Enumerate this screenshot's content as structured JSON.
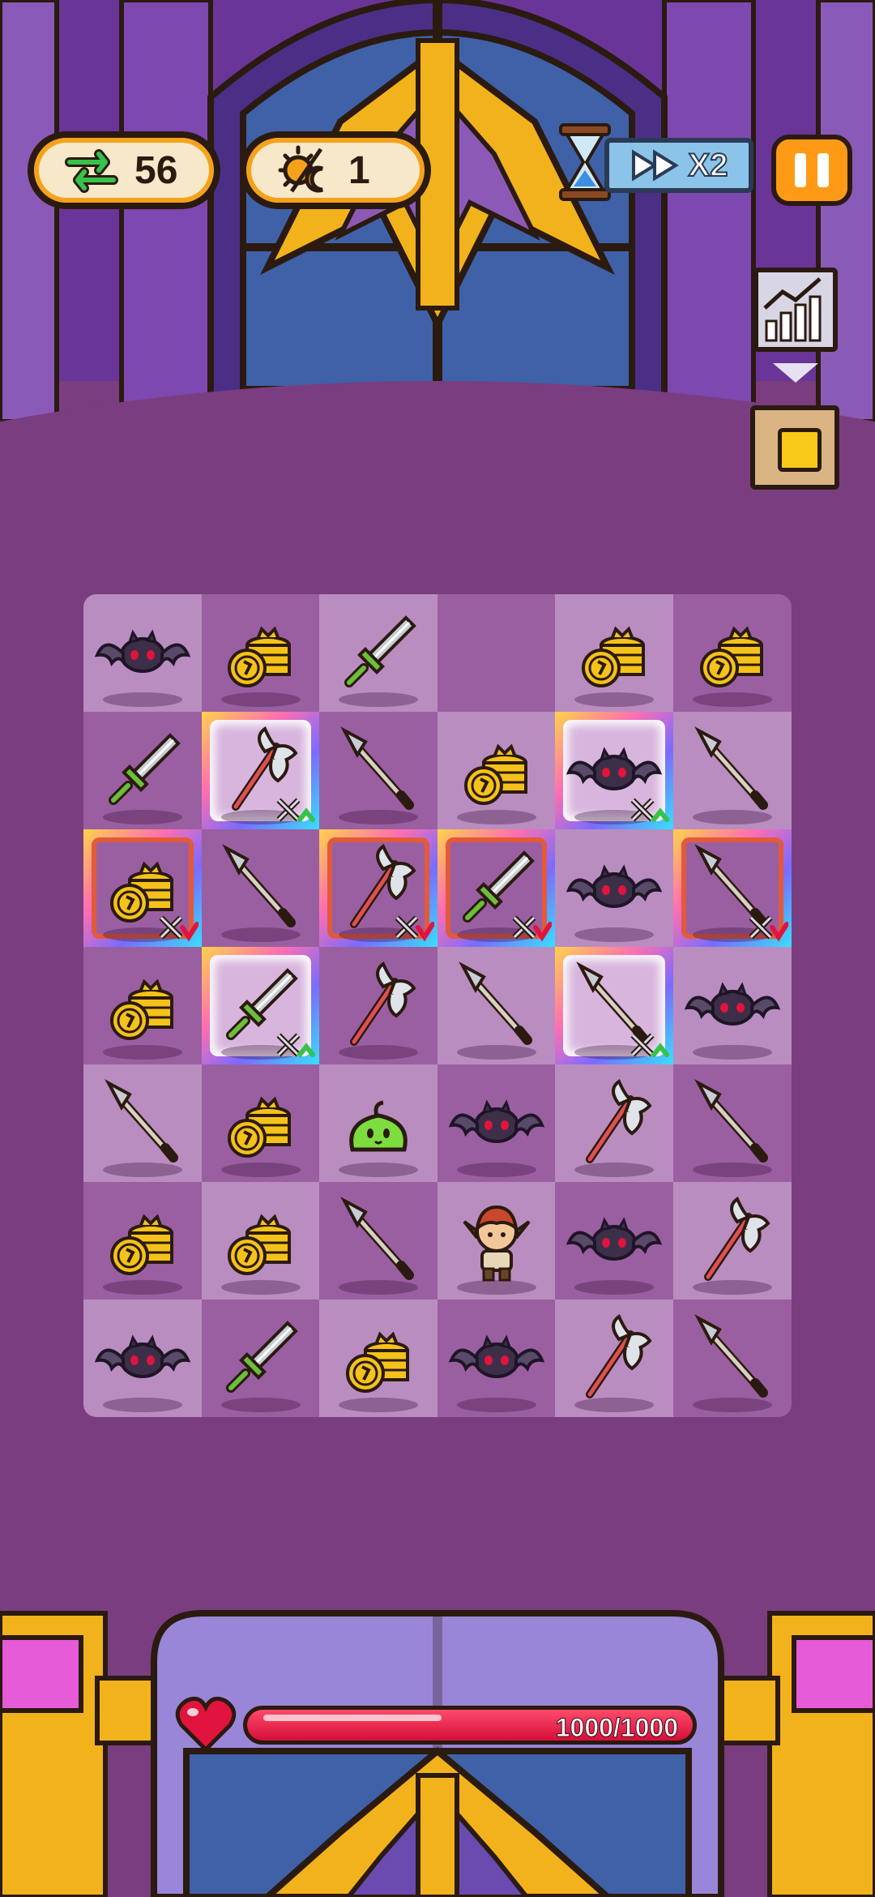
{
  "hud": {
    "moves": "56",
    "days": "1",
    "speed": "X2",
    "moves_icon": "swap-arrows-icon",
    "days_icon": "sun-moon-icon"
  },
  "player": {
    "hp_text": "1000/1000",
    "hp_fraction": 1.0
  },
  "board": {
    "rows": [
      [
        {
          "item": "bat"
        },
        {
          "item": "coins"
        },
        {
          "item": "sword"
        },
        {
          "item": "empty"
        },
        {
          "item": "coins"
        },
        {
          "item": "coins"
        }
      ],
      [
        {
          "item": "sword"
        },
        {
          "item": "axe",
          "frame": "white",
          "badge": "up"
        },
        {
          "item": "spear"
        },
        {
          "item": "coins"
        },
        {
          "item": "bat",
          "frame": "white",
          "badge": "up"
        },
        {
          "item": "spear"
        }
      ],
      [
        {
          "item": "coins",
          "frame": "orange",
          "badge": "down"
        },
        {
          "item": "spear"
        },
        {
          "item": "axe",
          "frame": "orange",
          "badge": "down"
        },
        {
          "item": "sword",
          "frame": "orange",
          "badge": "down"
        },
        {
          "item": "bat"
        },
        {
          "item": "spear",
          "frame": "orange",
          "badge": "down"
        }
      ],
      [
        {
          "item": "coins"
        },
        {
          "item": "sword",
          "frame": "white",
          "badge": "up"
        },
        {
          "item": "axe"
        },
        {
          "item": "spear"
        },
        {
          "item": "spear",
          "frame": "white",
          "badge": "up"
        },
        {
          "item": "bat"
        }
      ],
      [
        {
          "item": "spear"
        },
        {
          "item": "coins"
        },
        {
          "item": "slime"
        },
        {
          "item": "bat"
        },
        {
          "item": "axe"
        },
        {
          "item": "spear"
        }
      ],
      [
        {
          "item": "coins"
        },
        {
          "item": "coins"
        },
        {
          "item": "spear"
        },
        {
          "item": "hero"
        },
        {
          "item": "bat"
        },
        {
          "item": "axe"
        }
      ],
      [
        {
          "item": "bat"
        },
        {
          "item": "sword"
        },
        {
          "item": "coins"
        },
        {
          "item": "bat"
        },
        {
          "item": "axe"
        },
        {
          "item": "spear"
        }
      ]
    ]
  },
  "colors": {
    "accent": "#f5a21a",
    "hp": "#e0143c",
    "board_light": "#b98dc0",
    "board_dark": "#9a5fa1"
  }
}
